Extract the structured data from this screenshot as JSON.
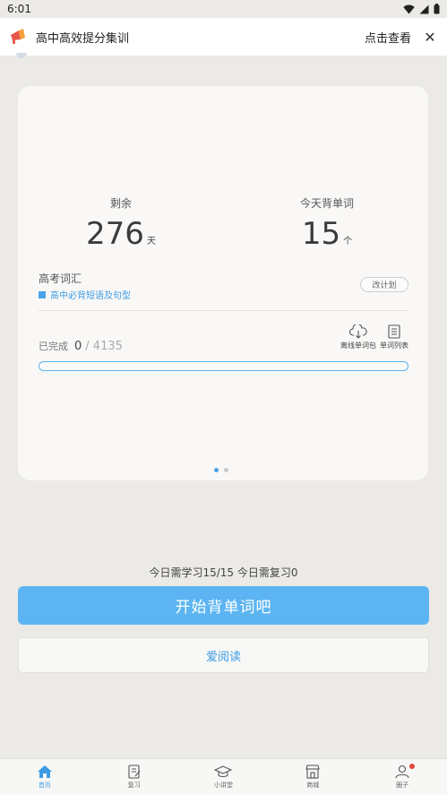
{
  "status_bar": {
    "time": "6:01"
  },
  "banner": {
    "title": "高中高效提分集训",
    "view_label": "点击查看",
    "close_label": "✕"
  },
  "card": {
    "remaining_label": "剩余",
    "remaining_value": "276",
    "remaining_unit": "天",
    "today_label": "今天背单词",
    "today_value": "15",
    "today_unit": "个",
    "vocab_title": "高考词汇",
    "vocab_subtitle": "高中必背短语及句型",
    "change_plan_label": "改计划",
    "done_label": "已完成",
    "done_count": "0",
    "done_total": "/ 4135",
    "progress_fraction": 0,
    "offline_pack_label": "离线单词包",
    "word_list_label": "单词列表"
  },
  "today_info": "今日需学习15/15   今日需复习0",
  "start_button_label": "开始背单词吧",
  "read_button_label": "爱阅读",
  "bottom_nav": {
    "items": [
      {
        "label": "首页",
        "icon": "home-icon",
        "active": true
      },
      {
        "label": "复习",
        "icon": "notebook-icon",
        "active": false
      },
      {
        "label": "小讲堂",
        "icon": "graduation-cap-icon",
        "active": false
      },
      {
        "label": "商城",
        "icon": "store-icon",
        "active": false
      },
      {
        "label": "圈子",
        "icon": "people-icon",
        "active": false
      }
    ]
  },
  "colors": {
    "accent": "#5cb5f2",
    "link": "#3d9be3",
    "badge": "#e5483a"
  }
}
